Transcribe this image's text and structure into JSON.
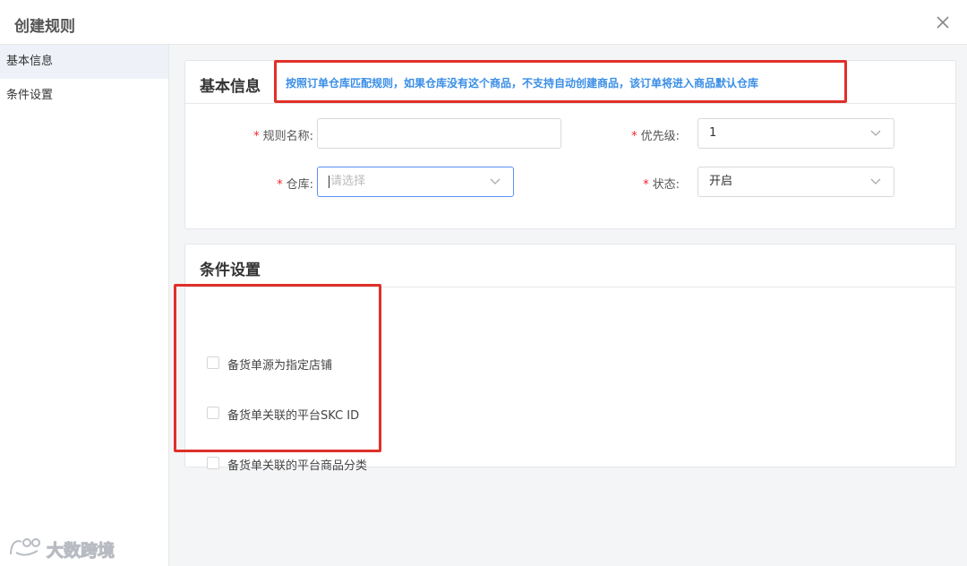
{
  "dialog": {
    "title": "创建规则",
    "close_icon": "close-icon"
  },
  "sidebar": {
    "items": [
      {
        "label": "基本信息",
        "active": true
      },
      {
        "label": "条件设置",
        "active": false
      }
    ]
  },
  "basic_info": {
    "title": "基本信息",
    "notice": "按照订单仓库匹配规则，如果仓库没有这个商品，不支持自动创建商品，该订单将进入商品默认仓库",
    "fields": {
      "rule_name": {
        "label": "规则名称:",
        "required": true,
        "value": ""
      },
      "priority": {
        "label": "优先级:",
        "required": true,
        "value": "1"
      },
      "warehouse": {
        "label": "仓库:",
        "required": true,
        "placeholder": "请选择"
      },
      "status": {
        "label": "状态:",
        "required": true,
        "value": "开启"
      }
    }
  },
  "conditions": {
    "title": "条件设置",
    "options": [
      {
        "label": "备货单源为指定店铺",
        "checked": false
      },
      {
        "label": "备货单关联的平台SKC ID",
        "checked": false
      },
      {
        "label": "备货单关联的平台商品分类",
        "checked": false
      }
    ]
  },
  "watermark": {
    "text": "大数跨境"
  },
  "colors": {
    "highlight_border": "#e0302a",
    "notice_text": "#3a8ee6",
    "required_star": "#f5222d",
    "focus_border": "#5b8ff9"
  }
}
